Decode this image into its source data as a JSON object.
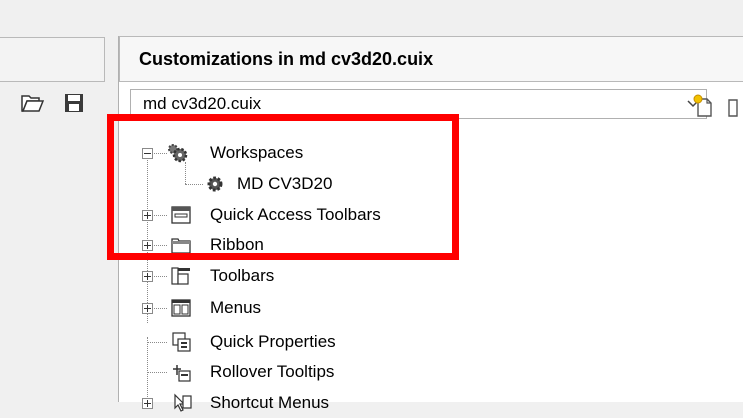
{
  "panel": {
    "title": "Customizations in md cv3d20.cuix",
    "selected_file": "md cv3d20.cuix"
  },
  "tree": {
    "workspaces": "Workspaces",
    "md_cv3d20": "MD CV3D20",
    "quick_access_toolbars": "Quick Access Toolbars",
    "ribbon": "Ribbon",
    "toolbars": "Toolbars",
    "menus": "Menus",
    "quick_properties": "Quick Properties",
    "rollover_tooltips": "Rollover Tooltips",
    "shortcut_menus": "Shortcut Menus"
  },
  "icons": {
    "open": "folder-open-icon",
    "save": "save-icon",
    "dropdown": "chevron-down-icon",
    "new": "new-file-icon"
  },
  "colors": {
    "highlight_box": "#ff0000",
    "panel_background": "#ffffff"
  }
}
